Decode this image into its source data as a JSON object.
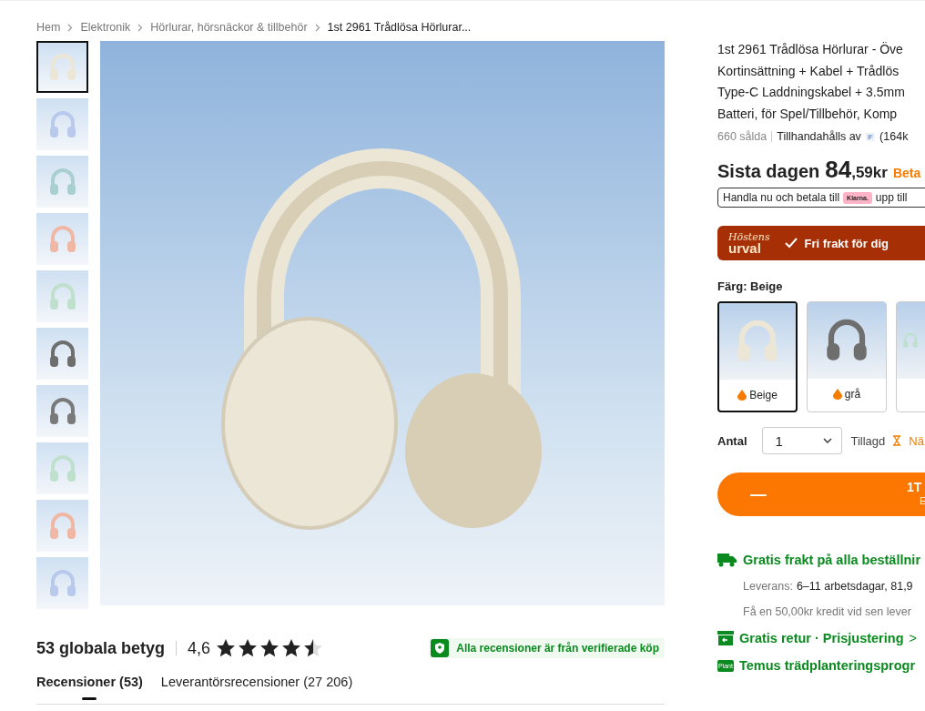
{
  "breadcrumb": [
    {
      "label": "Hem"
    },
    {
      "label": "Elektronik"
    },
    {
      "label": "Hörlurar, hörsnäckor & tillbehör"
    },
    {
      "label": "1st 2961 Trådlösa Hörlurar...",
      "current": true
    }
  ],
  "thumbnails": [
    {
      "selected": true,
      "color": "#ece6d6"
    },
    {
      "selected": false,
      "color": "#b9c9ec"
    },
    {
      "selected": false,
      "color": "#a9cfd0"
    },
    {
      "selected": false,
      "color": "#f0b7a4"
    },
    {
      "selected": false,
      "color": "#bfe0cc"
    },
    {
      "selected": false,
      "color": "#6e6e6e"
    },
    {
      "selected": false,
      "color": "#7a7a7a"
    },
    {
      "selected": false,
      "color": "#bfe0cc"
    },
    {
      "selected": false,
      "color": "#f0b7a4"
    },
    {
      "selected": false,
      "color": "#b9c9ec"
    }
  ],
  "main_image": {
    "color": "#ece6d6"
  },
  "reviews": {
    "count_label": "53 globala betyg",
    "rating": "4,6",
    "stars": 4.5,
    "verified": "Alla recensioner är från verifierade köp",
    "tabs": [
      {
        "label": "Recensioner (53)",
        "selected": true
      },
      {
        "label": "Leverantörsrecensioner (27 206)",
        "selected": false
      }
    ]
  },
  "product": {
    "title_lines": [
      "1st 2961 Trådlösa Hörlurar - Öve",
      "Kortinsättning + Kabel + Trådlös",
      "Type-C Laddningskabel + 3.5mm",
      "Batteri, för Spel/Tillbehör, Komp"
    ],
    "sold": "660 sålda",
    "supplied_by": "Tillhandahålls av",
    "seller_badge": "IF",
    "seller_count": "(164k",
    "price_prefix": "Sista dagen",
    "price_main": "84",
    "price_rest": ",59kr",
    "price_note": "Beta",
    "klarna_before": "Handla nu och betala till",
    "klarna_badge": "Klarna.",
    "klarna_after": "upp till",
    "banner_script": "Höstens",
    "banner_word": "urval",
    "banner_text": "Fri frakt för dig",
    "color_label": "Färg: Beige",
    "swatches": [
      {
        "label": "Beige",
        "selected": true,
        "color": "#ece6d6"
      },
      {
        "label": "grå",
        "selected": false,
        "color": "#6e6e6e"
      },
      {
        "selected": false,
        "color": "#bfe0cc"
      }
    ],
    "quantity_label": "Antal",
    "quantity": "1",
    "added_label": "Tillagd",
    "added_note": "Nä",
    "cart_button": {
      "symbol": "—",
      "line1": "1T",
      "line2": "E"
    },
    "shipping": [
      {
        "kind": "truck",
        "title": "Gratis frakt på alla beställnir"
      },
      {
        "kind": "text",
        "label": "Leverans:",
        "value": "6–11 arbetsdagar, 81,9"
      },
      {
        "kind": "note",
        "value": "Få en 50,00kr kredit vid sen lever"
      },
      {
        "kind": "box",
        "title": "Gratis retur · Prisjustering",
        "arrow": ">"
      },
      {
        "kind": "plant",
        "badge": "Plant",
        "title": "Temus trädplanteringsprogr"
      }
    ]
  }
}
